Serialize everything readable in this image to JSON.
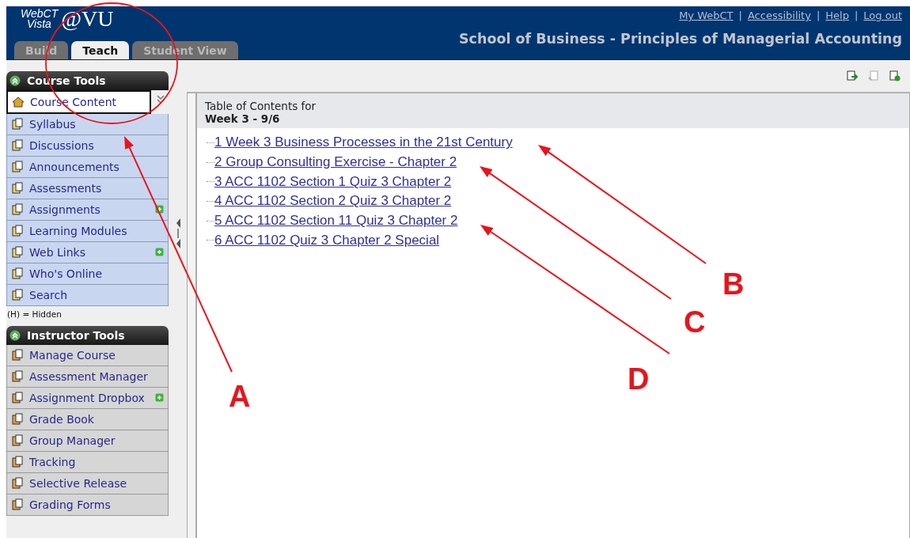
{
  "header": {
    "logo_top": "WebCT",
    "logo_bottom": "Vista",
    "logo_mark": "@VU",
    "links": [
      "My WebCT",
      "Accessibility",
      "Help",
      "Log out"
    ],
    "separator": "|",
    "course_title": "School of Business - Principles of Managerial Accounting"
  },
  "tabs": [
    {
      "label": "Build",
      "selected": false
    },
    {
      "label": "Teach",
      "selected": true
    },
    {
      "label": "Student View",
      "selected": false
    }
  ],
  "course_tools": {
    "title": "Course Tools",
    "items": [
      {
        "label": "Course Content",
        "selected": true,
        "has_new": false
      },
      {
        "label": "Syllabus",
        "selected": false,
        "has_new": false
      },
      {
        "label": "Discussions",
        "selected": false,
        "has_new": false
      },
      {
        "label": "Announcements",
        "selected": false,
        "has_new": false
      },
      {
        "label": "Assessments",
        "selected": false,
        "has_new": false
      },
      {
        "label": "Assignments",
        "selected": false,
        "has_new": true
      },
      {
        "label": "Learning Modules",
        "selected": false,
        "has_new": false
      },
      {
        "label": "Web Links",
        "selected": false,
        "has_new": true
      },
      {
        "label": "Who's Online",
        "selected": false,
        "has_new": false
      },
      {
        "label": "Search",
        "selected": false,
        "has_new": false
      }
    ],
    "legend": "(H) = Hidden"
  },
  "instructor_tools": {
    "title": "Instructor Tools",
    "items": [
      {
        "label": "Manage Course",
        "has_new": false
      },
      {
        "label": "Assessment Manager",
        "has_new": false
      },
      {
        "label": "Assignment Dropbox",
        "has_new": true
      },
      {
        "label": "Grade Book",
        "has_new": false
      },
      {
        "label": "Group Manager",
        "has_new": false
      },
      {
        "label": "Tracking",
        "has_new": false
      },
      {
        "label": "Selective Release",
        "has_new": false
      },
      {
        "label": "Grading Forms",
        "has_new": false
      }
    ]
  },
  "content": {
    "heading": "Table of Contents for",
    "subheading": "Week 3 - 9/6",
    "items": [
      "1 Week 3 Business Processes in the 21st Century",
      "2 Group Consulting Exercise - Chapter 2",
      "3 ACC 1102 Section 1 Quiz 3 Chapter 2",
      "4 ACC 1102 Section 2 Quiz 3 Chapter 2",
      "5 ACC 1102 Section 11 Quiz 3 Chapter 2",
      "6 ACC 1102 Quiz 3 Chapter 2 Special"
    ]
  },
  "annotations": [
    "A",
    "B",
    "C",
    "D"
  ]
}
